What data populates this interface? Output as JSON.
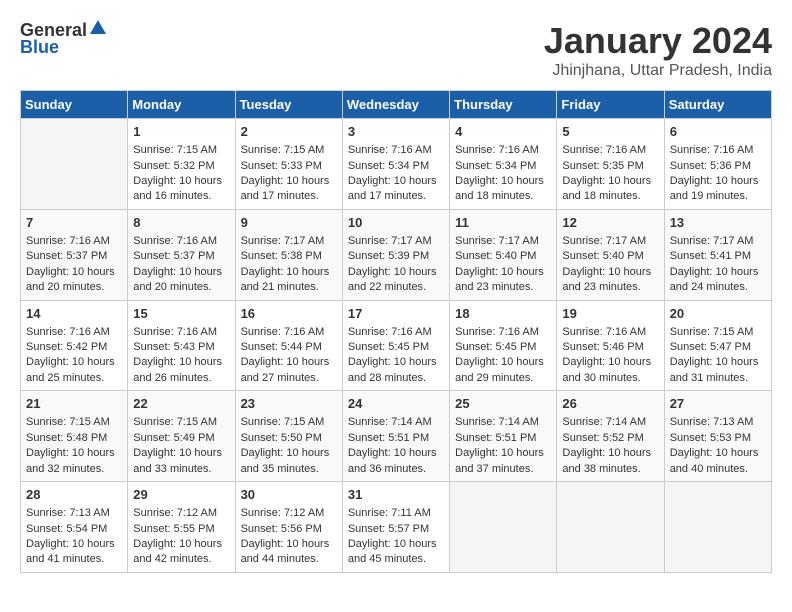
{
  "header": {
    "logo_general": "General",
    "logo_blue": "Blue",
    "title": "January 2024",
    "location": "Jhinjhana, Uttar Pradesh, India"
  },
  "weekdays": [
    "Sunday",
    "Monday",
    "Tuesday",
    "Wednesday",
    "Thursday",
    "Friday",
    "Saturday"
  ],
  "weeks": [
    [
      {
        "day": "",
        "sunrise": "",
        "sunset": "",
        "daylight": ""
      },
      {
        "day": "1",
        "sunrise": "Sunrise: 7:15 AM",
        "sunset": "Sunset: 5:32 PM",
        "daylight": "Daylight: 10 hours and 16 minutes."
      },
      {
        "day": "2",
        "sunrise": "Sunrise: 7:15 AM",
        "sunset": "Sunset: 5:33 PM",
        "daylight": "Daylight: 10 hours and 17 minutes."
      },
      {
        "day": "3",
        "sunrise": "Sunrise: 7:16 AM",
        "sunset": "Sunset: 5:34 PM",
        "daylight": "Daylight: 10 hours and 17 minutes."
      },
      {
        "day": "4",
        "sunrise": "Sunrise: 7:16 AM",
        "sunset": "Sunset: 5:34 PM",
        "daylight": "Daylight: 10 hours and 18 minutes."
      },
      {
        "day": "5",
        "sunrise": "Sunrise: 7:16 AM",
        "sunset": "Sunset: 5:35 PM",
        "daylight": "Daylight: 10 hours and 18 minutes."
      },
      {
        "day": "6",
        "sunrise": "Sunrise: 7:16 AM",
        "sunset": "Sunset: 5:36 PM",
        "daylight": "Daylight: 10 hours and 19 minutes."
      }
    ],
    [
      {
        "day": "7",
        "sunrise": "Sunrise: 7:16 AM",
        "sunset": "Sunset: 5:37 PM",
        "daylight": "Daylight: 10 hours and 20 minutes."
      },
      {
        "day": "8",
        "sunrise": "Sunrise: 7:16 AM",
        "sunset": "Sunset: 5:37 PM",
        "daylight": "Daylight: 10 hours and 20 minutes."
      },
      {
        "day": "9",
        "sunrise": "Sunrise: 7:17 AM",
        "sunset": "Sunset: 5:38 PM",
        "daylight": "Daylight: 10 hours and 21 minutes."
      },
      {
        "day": "10",
        "sunrise": "Sunrise: 7:17 AM",
        "sunset": "Sunset: 5:39 PM",
        "daylight": "Daylight: 10 hours and 22 minutes."
      },
      {
        "day": "11",
        "sunrise": "Sunrise: 7:17 AM",
        "sunset": "Sunset: 5:40 PM",
        "daylight": "Daylight: 10 hours and 23 minutes."
      },
      {
        "day": "12",
        "sunrise": "Sunrise: 7:17 AM",
        "sunset": "Sunset: 5:40 PM",
        "daylight": "Daylight: 10 hours and 23 minutes."
      },
      {
        "day": "13",
        "sunrise": "Sunrise: 7:17 AM",
        "sunset": "Sunset: 5:41 PM",
        "daylight": "Daylight: 10 hours and 24 minutes."
      }
    ],
    [
      {
        "day": "14",
        "sunrise": "Sunrise: 7:16 AM",
        "sunset": "Sunset: 5:42 PM",
        "daylight": "Daylight: 10 hours and 25 minutes."
      },
      {
        "day": "15",
        "sunrise": "Sunrise: 7:16 AM",
        "sunset": "Sunset: 5:43 PM",
        "daylight": "Daylight: 10 hours and 26 minutes."
      },
      {
        "day": "16",
        "sunrise": "Sunrise: 7:16 AM",
        "sunset": "Sunset: 5:44 PM",
        "daylight": "Daylight: 10 hours and 27 minutes."
      },
      {
        "day": "17",
        "sunrise": "Sunrise: 7:16 AM",
        "sunset": "Sunset: 5:45 PM",
        "daylight": "Daylight: 10 hours and 28 minutes."
      },
      {
        "day": "18",
        "sunrise": "Sunrise: 7:16 AM",
        "sunset": "Sunset: 5:45 PM",
        "daylight": "Daylight: 10 hours and 29 minutes."
      },
      {
        "day": "19",
        "sunrise": "Sunrise: 7:16 AM",
        "sunset": "Sunset: 5:46 PM",
        "daylight": "Daylight: 10 hours and 30 minutes."
      },
      {
        "day": "20",
        "sunrise": "Sunrise: 7:15 AM",
        "sunset": "Sunset: 5:47 PM",
        "daylight": "Daylight: 10 hours and 31 minutes."
      }
    ],
    [
      {
        "day": "21",
        "sunrise": "Sunrise: 7:15 AM",
        "sunset": "Sunset: 5:48 PM",
        "daylight": "Daylight: 10 hours and 32 minutes."
      },
      {
        "day": "22",
        "sunrise": "Sunrise: 7:15 AM",
        "sunset": "Sunset: 5:49 PM",
        "daylight": "Daylight: 10 hours and 33 minutes."
      },
      {
        "day": "23",
        "sunrise": "Sunrise: 7:15 AM",
        "sunset": "Sunset: 5:50 PM",
        "daylight": "Daylight: 10 hours and 35 minutes."
      },
      {
        "day": "24",
        "sunrise": "Sunrise: 7:14 AM",
        "sunset": "Sunset: 5:51 PM",
        "daylight": "Daylight: 10 hours and 36 minutes."
      },
      {
        "day": "25",
        "sunrise": "Sunrise: 7:14 AM",
        "sunset": "Sunset: 5:51 PM",
        "daylight": "Daylight: 10 hours and 37 minutes."
      },
      {
        "day": "26",
        "sunrise": "Sunrise: 7:14 AM",
        "sunset": "Sunset: 5:52 PM",
        "daylight": "Daylight: 10 hours and 38 minutes."
      },
      {
        "day": "27",
        "sunrise": "Sunrise: 7:13 AM",
        "sunset": "Sunset: 5:53 PM",
        "daylight": "Daylight: 10 hours and 40 minutes."
      }
    ],
    [
      {
        "day": "28",
        "sunrise": "Sunrise: 7:13 AM",
        "sunset": "Sunset: 5:54 PM",
        "daylight": "Daylight: 10 hours and 41 minutes."
      },
      {
        "day": "29",
        "sunrise": "Sunrise: 7:12 AM",
        "sunset": "Sunset: 5:55 PM",
        "daylight": "Daylight: 10 hours and 42 minutes."
      },
      {
        "day": "30",
        "sunrise": "Sunrise: 7:12 AM",
        "sunset": "Sunset: 5:56 PM",
        "daylight": "Daylight: 10 hours and 44 minutes."
      },
      {
        "day": "31",
        "sunrise": "Sunrise: 7:11 AM",
        "sunset": "Sunset: 5:57 PM",
        "daylight": "Daylight: 10 hours and 45 minutes."
      },
      {
        "day": "",
        "sunrise": "",
        "sunset": "",
        "daylight": ""
      },
      {
        "day": "",
        "sunrise": "",
        "sunset": "",
        "daylight": ""
      },
      {
        "day": "",
        "sunrise": "",
        "sunset": "",
        "daylight": ""
      }
    ]
  ]
}
